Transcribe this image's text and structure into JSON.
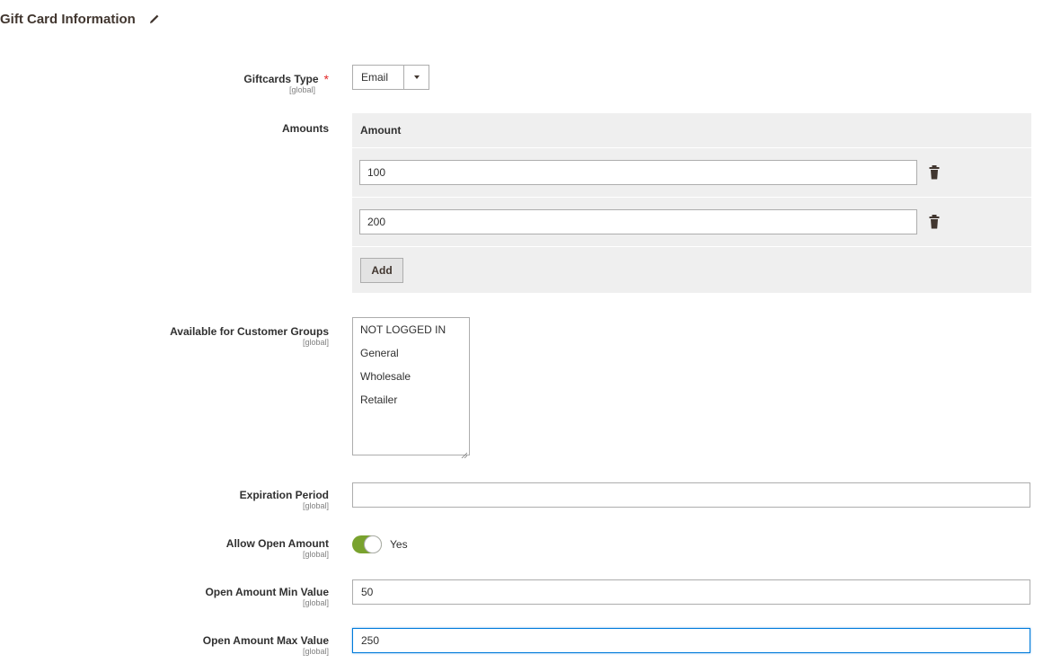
{
  "section": {
    "title": "Gift Card Information"
  },
  "fields": {
    "giftcards_type": {
      "label": "Giftcards Type",
      "scope": "[global]",
      "required_mark": "*",
      "value": "Email"
    },
    "amounts": {
      "label": "Amounts",
      "column_header": "Amount",
      "rows": [
        "100",
        "200"
      ],
      "add_label": "Add"
    },
    "customer_groups": {
      "label": "Available for Customer Groups",
      "scope": "[global]",
      "options": [
        "NOT LOGGED IN",
        "General",
        "Wholesale",
        "Retailer"
      ]
    },
    "expiration_period": {
      "label": "Expiration Period",
      "scope": "[global]",
      "value": ""
    },
    "allow_open_amount": {
      "label": "Allow Open Amount",
      "scope": "[global]",
      "state_label": "Yes",
      "checked": true
    },
    "open_amount_min": {
      "label": "Open Amount Min Value",
      "scope": "[global]",
      "value": "50"
    },
    "open_amount_max": {
      "label": "Open Amount Max Value",
      "scope": "[global]",
      "value": "250"
    }
  },
  "colors": {
    "toggle_on": "#79a22e",
    "required": "#e22626",
    "focus_border": "#007bdb",
    "grid_bg": "#efefef"
  },
  "icons": {
    "edit": "pencil-icon",
    "delete": "trash-icon",
    "dropdown": "chevron-down-icon"
  }
}
